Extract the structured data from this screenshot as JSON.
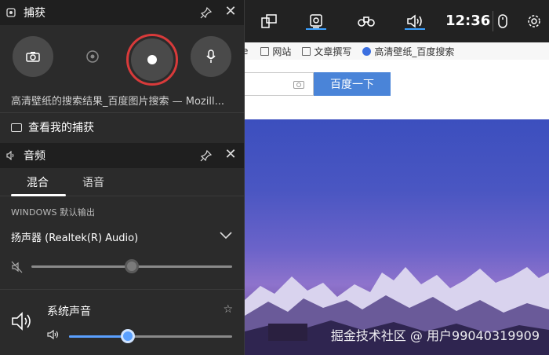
{
  "browser": {
    "bookmarks": [
      {
        "label": "网站"
      },
      {
        "label": "文章撰写"
      },
      {
        "label": "高清壁纸_百度搜索"
      }
    ],
    "bookmark_fragment": "e",
    "search_button": "百度一下",
    "watermark": "掘金技术社区 @ 用户99040319909"
  },
  "topbar": {
    "clock": "12:36",
    "icons": [
      "widget-menu-icon",
      "capture-icon",
      "binoculars-icon",
      "audio-icon",
      "mouse-icon",
      "settings-icon"
    ],
    "accent": "#3aa0ff"
  },
  "capture": {
    "title": "捕获",
    "window_title": "高清壁纸的搜索结果_百度图片搜索 — Mozill...",
    "show_captures": "查看我的捕获",
    "record_ring_color": "#d83a3a"
  },
  "audio": {
    "title": "音频",
    "tabs": [
      {
        "label": "混合"
      },
      {
        "label": "语音"
      }
    ],
    "section_label": "WINDOWS 默认输出",
    "device": "扬声器 (Realtek(R) Audio)",
    "master_volume": 0.5,
    "system_sound_label": "系统声音",
    "system_volume": 0.36,
    "slider_accent": "#5aa0ff"
  }
}
